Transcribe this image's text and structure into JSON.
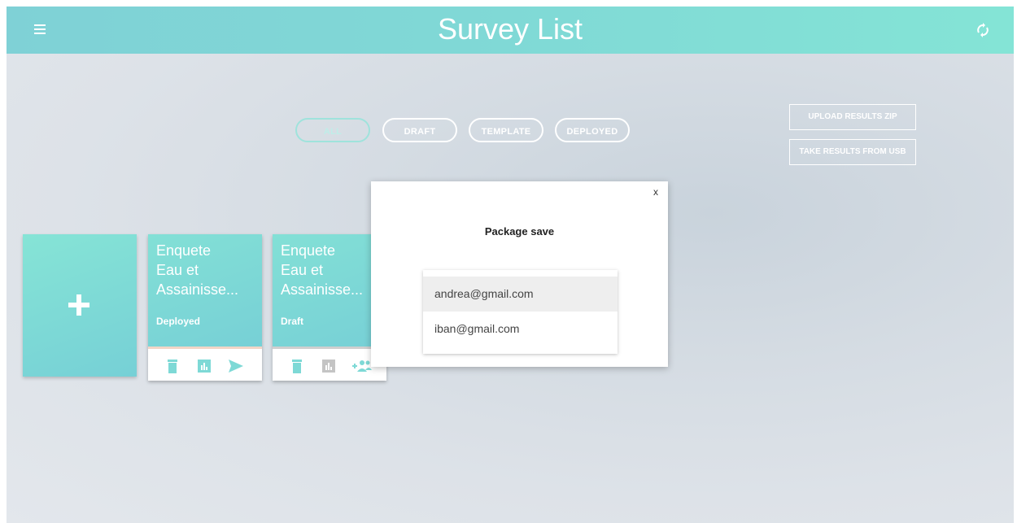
{
  "header": {
    "title": "Survey List",
    "menu_icon": "menu-icon",
    "sync_icon": "sync-icon"
  },
  "filters": {
    "items": [
      {
        "label": "ALL",
        "active": true
      },
      {
        "label": "DRAFT",
        "active": false
      },
      {
        "label": "TEMPLATE",
        "active": false
      },
      {
        "label": "DEPLOYED",
        "active": false
      }
    ]
  },
  "actions": {
    "upload_zip": "UPLOAD RESULTS ZIP",
    "take_usb": "TAKE RESULTS FROM USB"
  },
  "add_card": {
    "icon": "plus-icon"
  },
  "surveys": [
    {
      "name": "Enquete\nEau et\nAssainisse...",
      "status": "Deployed",
      "stripe_color": "#f2d5c6",
      "actions": [
        "trash-icon",
        "chart-icon",
        "send-icon"
      ]
    },
    {
      "name": "Enquete\nEau et\nAssainisse...",
      "status": "Draft",
      "stripe_color": "#cfcfcf",
      "actions": [
        "trash-icon",
        "chart-icon",
        "add-users-icon"
      ]
    }
  ],
  "modal": {
    "title": "Package save",
    "close_label": "x",
    "emails": [
      {
        "label": "andrea@gmail.com",
        "selected": true
      },
      {
        "label": "iban@gmail.com",
        "selected": false
      }
    ]
  },
  "colors": {
    "accent": "#80d9d6",
    "icon_active": "#7ed9d6",
    "icon_muted": "#c4c4c4"
  }
}
